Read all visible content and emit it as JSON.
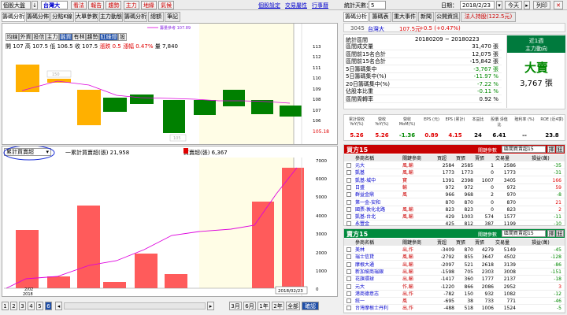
{
  "toolbar": {
    "mode_label": "個股大盤",
    "mode_value": "↓",
    "stock_name": "台灣大",
    "tags": [
      "看法",
      "報告",
      "趨勢",
      "主力",
      "地緣",
      "氣候"
    ],
    "links": [
      "個股設定",
      "交易屬性",
      "行事曆"
    ],
    "count_label": "統計天數：",
    "count_value": "5",
    "date_label": "日期：",
    "date_value": "2018/2/23",
    "today_button": "今天",
    "print_button": "列印"
  },
  "left_tabs": [
    "籌碼分析",
    "籌碼分佈",
    "分點K線",
    "大單參數",
    "主力動態",
    "籌碼分析",
    "總額",
    "筆記"
  ],
  "chart_toolbar": [
    "均線",
    "外資",
    "投信",
    "主力",
    "融資",
    "有林",
    "趨勢",
    "紅綠燈",
    "設"
  ],
  "ohlc": {
    "open_label": "開",
    "open": "107",
    "high_label": "高",
    "high": "107.5",
    "low_label": "低",
    "low": "106.5",
    "close_label": "收",
    "close": "107.5",
    "chg_label": "漲跌",
    "chg": "0.5",
    "pct_label": "漲幅",
    "pct": "0.47%",
    "vol_label": "量",
    "vol": "7,840"
  },
  "price_chart": {
    "ma_label": "籌量參考 107.89",
    "label_mark": "150",
    "label_mark2": "105",
    "last_price": "105.18",
    "yaxis": [
      "113",
      "112",
      "111",
      "110",
      "109",
      "108",
      "107",
      "106",
      "105"
    ]
  },
  "chip_panel": {
    "select_value": "累計買賣超",
    "legend1": "一累計買賣超(張) 21,958",
    "legend2": "買賣超(張) 6,367",
    "date_tag": "2018/02/23",
    "x_start": "2/02",
    "x_year": "2018",
    "yaxis": [
      "7000",
      "6000",
      "5000",
      "4000",
      "3000",
      "2000",
      "1000",
      "0"
    ]
  },
  "pager": {
    "pages": [
      "1",
      "2",
      "3",
      "4",
      "5",
      "6"
    ],
    "ranges": [
      "3月",
      "6月",
      "1年",
      "2年",
      "全部"
    ],
    "confirm": "確認"
  },
  "right_tabs": [
    "籌碼分析",
    "籌碼表",
    "重大事件",
    "新聞",
    "公開資訊",
    "法人持股(122.5元)"
  ],
  "stock_header": {
    "code": "3045",
    "name": "台灣大",
    "price": "107.5元",
    "change": "+0.5 (+0.47%)"
  },
  "stats": {
    "period_label": "統計區間",
    "period": "20180209 ~ 20180223",
    "rows": [
      {
        "label": "區間成交量",
        "value": "31,470 張",
        "color": "#000"
      },
      {
        "label": "區間前15名合計",
        "value": "12,075 張",
        "color": "#000"
      },
      {
        "label": "區間前15名合計",
        "value": "-15,842 張",
        "color": "#000"
      },
      {
        "label": "5日籌碼集中",
        "value": "-3,767 張",
        "color": "#008800"
      },
      {
        "label": "5日籌碼集中(%)",
        "value": "-11.97 %",
        "color": "#008800"
      },
      {
        "label": "20日籌碼集中(%)",
        "value": "-7.22 %",
        "color": "#008800"
      },
      {
        "label": "佔股本比重",
        "value": "-0.11 %",
        "color": "#008800"
      },
      {
        "label": "區間周轉率",
        "value": "0.92 %",
        "color": "#000"
      }
    ],
    "box_title1": "近1週",
    "box_title2": "主力動向",
    "box_main": "大賣",
    "box_value": "3,767 張"
  },
  "fundamentals": {
    "headers": [
      "累計營收 YoY(%)",
      "營收 YoY(%)",
      "營收 MoM(%)",
      "EPS (元)",
      "EPS (累計)",
      "本益比",
      "股價 淨值比",
      "殖利率 (%)",
      "ROE (近4季)"
    ],
    "values": [
      "5.26",
      "5.26",
      "-1.36",
      "0.89",
      "4.15",
      "24",
      "6.41",
      "--",
      "23.8"
    ],
    "colors": [
      "#e00000",
      "#e00000",
      "#008800",
      "#e00000",
      "#e00000",
      "#000",
      "#000",
      "#000",
      "#000"
    ]
  },
  "buy_table": {
    "title": "買方15",
    "filter_label": "關鍵參數",
    "filter_value": "區間買賣超15",
    "btn1": "擇",
    "btn2": "鈕",
    "headers": [
      "參商名稱",
      "關鍵參商",
      "買超",
      "買張",
      "賣張",
      "交易量",
      "損益(萬)"
    ],
    "rows": [
      [
        "元大",
        "風,輸",
        "2584",
        "2585",
        "1",
        "2586",
        "-35"
      ],
      [
        "凱基",
        "風,輸",
        "1773",
        "1773",
        "0",
        "1773",
        "-31"
      ],
      [
        "凱基-城中",
        "寶",
        "1391",
        "2398",
        "1007",
        "3405",
        "166"
      ],
      [
        "日盛",
        "輸",
        "972",
        "972",
        "0",
        "972",
        "59"
      ],
      [
        "群益金鼎",
        "風",
        "966",
        "968",
        "2",
        "970",
        "-8"
      ],
      [
        "第一金-安和",
        "",
        "870",
        "870",
        "0",
        "870",
        "21"
      ],
      [
        "國票-敦化北路",
        "風,輸",
        "823",
        "823",
        "0",
        "823",
        "2"
      ],
      [
        "凱基-台北",
        "風,輸",
        "429",
        "1003",
        "574",
        "1577",
        "-11"
      ],
      [
        "永豐金",
        "",
        "425",
        "812",
        "387",
        "1199",
        "-10"
      ]
    ]
  },
  "sell_table": {
    "title": "賣方15",
    "filter_label": "關鍵參數",
    "filter_value": "區間買賣超15",
    "btn1": "擇",
    "btn2": "鈕",
    "headers": [
      "參商名稱",
      "關鍵參商",
      "賣超",
      "買張",
      "賣張",
      "交易量",
      "損益(萬)"
    ],
    "rows": [
      [
        "美林",
        "出,作",
        "-3409",
        "870",
        "4279",
        "5149",
        "-45"
      ],
      [
        "瑞士信貸",
        "風,輸",
        "-2792",
        "855",
        "3647",
        "4502",
        "-128"
      ],
      [
        "摩根大通",
        "出,輸",
        "-2097",
        "521",
        "2618",
        "3139",
        "-86"
      ],
      [
        "新加坡商瑞銀",
        "出,輸",
        "-1598",
        "705",
        "2303",
        "3008",
        "-151"
      ],
      [
        "花旗環球",
        "出,輸",
        "-1417",
        "360",
        "1777",
        "2137",
        "-18"
      ],
      [
        "元大",
        "作,輸",
        "-1220",
        "866",
        "2086",
        "2952",
        "3"
      ],
      [
        "港商德意志",
        "出,作",
        "-782",
        "150",
        "932",
        "1082",
        "-12"
      ],
      [
        "統一",
        "風",
        "-695",
        "38",
        "733",
        "771",
        "-46"
      ],
      [
        "台灣摩根士丹利",
        "出,作",
        "-488",
        "518",
        "1006",
        "1524",
        "-5"
      ]
    ]
  },
  "colors": {
    "up": "#e00000",
    "down": "#008800",
    "accent": "#cc0000",
    "rise_bar": "#ffb000",
    "fall_bar": "#008000"
  }
}
